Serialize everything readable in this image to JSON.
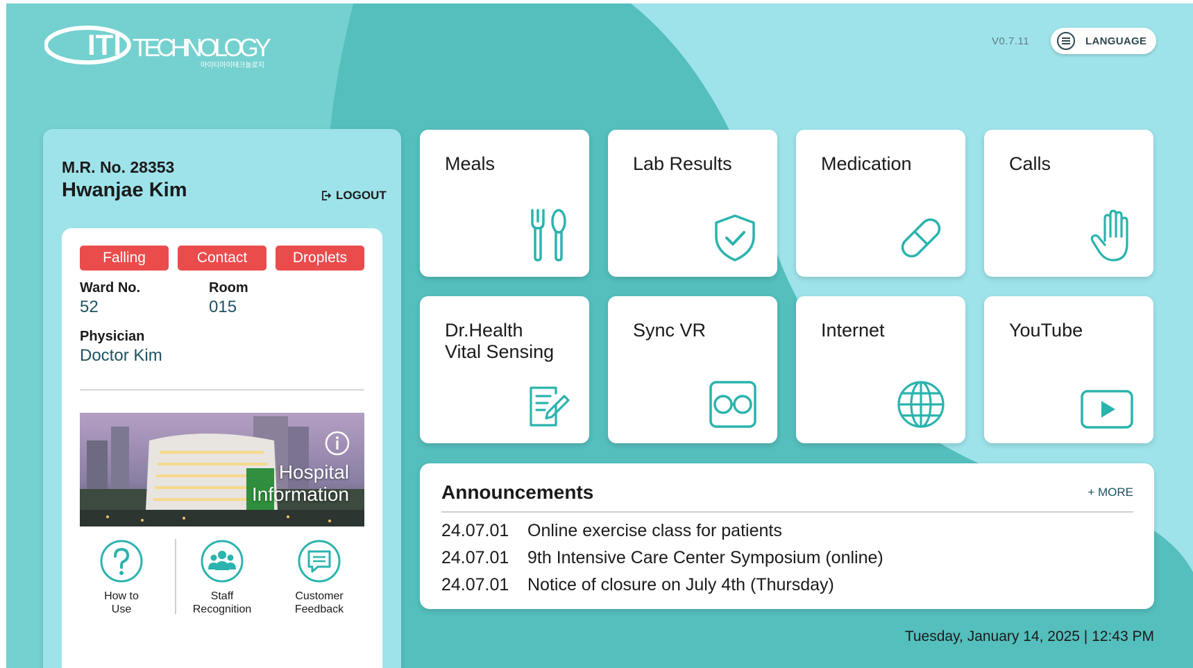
{
  "header": {
    "logo_text": "ITI TECHNOLOGY",
    "logo_subtext": "아이티아이테크놀로지",
    "version": "V0.7.11",
    "language_label": "LANGUAGE"
  },
  "patient": {
    "mrn_label": "M.R. No. 28353",
    "name": "Hwanjae Kim",
    "logout_label": "LOGOUT",
    "tags": [
      "Falling",
      "Contact",
      "Droplets"
    ],
    "ward_label": "Ward No.",
    "ward_value": "52",
    "room_label": "Room",
    "room_value": "015",
    "physician_label": "Physician",
    "physician_value": "Doctor Kim",
    "hospital_info_label": "Hospital\nInformation"
  },
  "quick_links": [
    {
      "label": "How to\nUse",
      "icon": "question-icon"
    },
    {
      "label": "Staff\nRecognition",
      "icon": "people-icon"
    },
    {
      "label": "Customer\nFeedback",
      "icon": "chat-icon"
    }
  ],
  "tiles": [
    {
      "label": "Meals",
      "icon": "fork-spoon-icon"
    },
    {
      "label": "Lab Results",
      "icon": "shield-check-icon"
    },
    {
      "label": "Medication",
      "icon": "pill-icon"
    },
    {
      "label": "Calls",
      "icon": "hand-icon"
    },
    {
      "label": "Dr.Health\nVital Sensing",
      "icon": "note-pen-icon"
    },
    {
      "label": "Sync VR",
      "icon": "vr-headset-icon"
    },
    {
      "label": "Internet",
      "icon": "globe-icon"
    },
    {
      "label": "YouTube",
      "icon": "play-icon"
    }
  ],
  "announcements": {
    "title": "Announcements",
    "more_label": "+ MORE",
    "items": [
      {
        "date": "24.07.01",
        "text": "Online exercise class for patients"
      },
      {
        "date": "24.07.01",
        "text": "9th Intensive Care Center Symposium (online)"
      },
      {
        "date": "24.07.01",
        "text": "Notice of closure on July 4th (Thursday)"
      }
    ]
  },
  "datetime": "Tuesday, January 14, 2025 | 12:43 PM",
  "colors": {
    "accent": "#2bb3ad",
    "background": "#9ee3ea",
    "tag_red": "#ea4c4c",
    "text_teal": "#1d5262"
  }
}
